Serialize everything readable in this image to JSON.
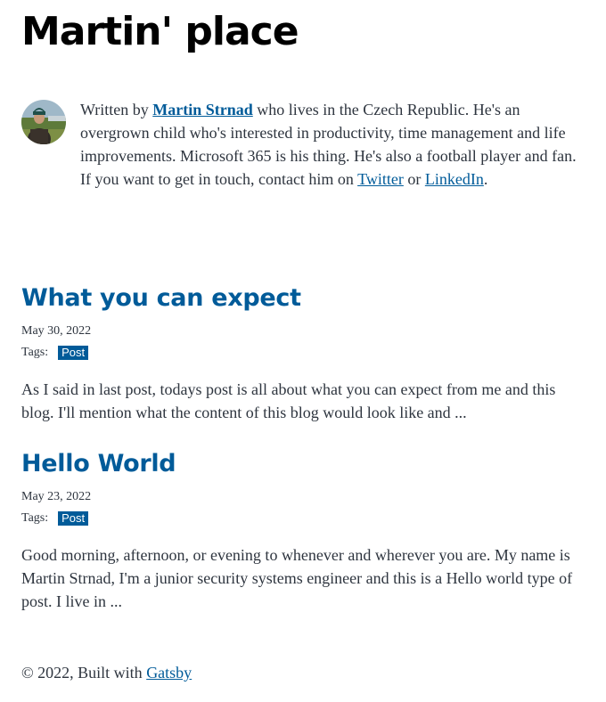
{
  "site": {
    "title": "Martin' place"
  },
  "bio": {
    "prefix": "Written by ",
    "author_name": "Martin Strnad",
    "middle": " who lives in the Czech Republic. He's an overgrown child who's interested in productivity, time management and life improvements. Microsoft 365 is his thing. He's also a football player and fan. If you want to get in touch, contact him on ",
    "twitter_label": "Twitter",
    "or_text": " or ",
    "linkedin_label": "LinkedIn",
    "suffix": "."
  },
  "posts": [
    {
      "title": "What you can expect",
      "date": "May 30, 2022",
      "tags_label": "Tags:",
      "tag": "Post",
      "excerpt": "As I said in last post, todays post is all about what you can expect from me and this blog. I'll mention what the content of this blog would look like and ..."
    },
    {
      "title": "Hello World",
      "date": "May 23, 2022",
      "tags_label": "Tags:",
      "tag": "Post",
      "excerpt": "Good morning, afternoon, or evening to whenever and wherever you are. My name is Martin Strnad, I'm a junior security systems engineer and this is a Hello world type of post. I live in ..."
    }
  ],
  "footer": {
    "copyright": "© 2022, Built with ",
    "gatsby_label": "Gatsby"
  },
  "colors": {
    "link": "#005b99",
    "text": "#2e353f",
    "title": "#000000"
  }
}
